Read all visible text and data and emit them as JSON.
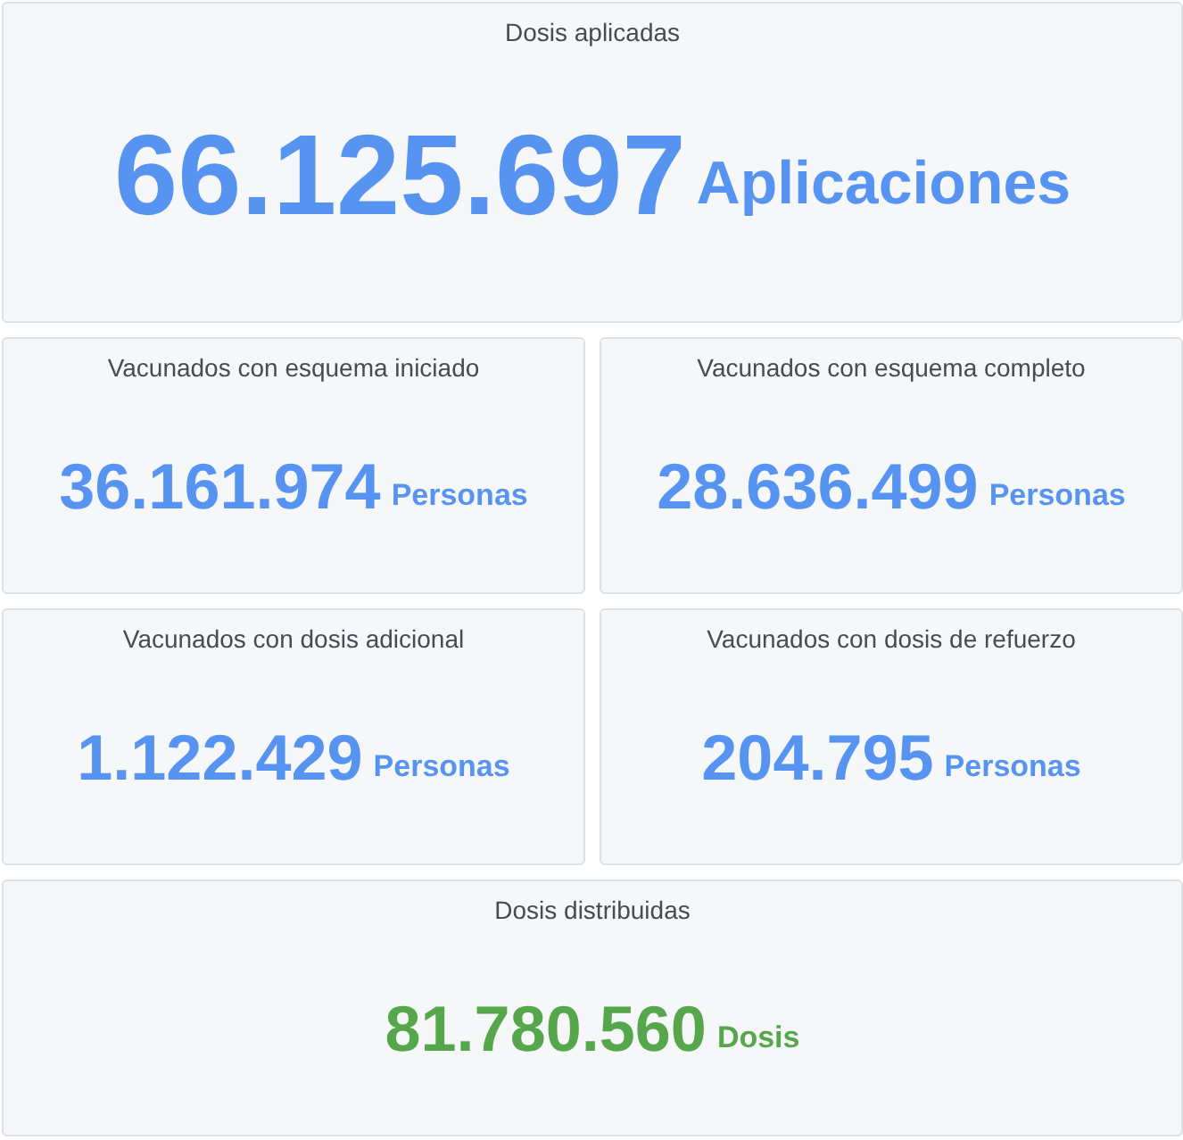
{
  "rows": [
    [
      {
        "kind": "hero",
        "title": "Dosis aplicadas",
        "value": "66.125.697",
        "unit": "Aplicaciones",
        "color": "#5794f2"
      }
    ],
    [
      {
        "kind": "stat",
        "title": "Vacunados con esquema iniciado",
        "value": "36.161.974",
        "unit": "Personas",
        "color": "#5794f2"
      },
      {
        "kind": "stat",
        "title": "Vacunados con esquema completo",
        "value": "28.636.499",
        "unit": "Personas",
        "color": "#5794f2"
      }
    ],
    [
      {
        "kind": "stat",
        "title": "Vacunados con dosis adicional",
        "value": "1.122.429",
        "unit": "Personas",
        "color": "#5794f2"
      },
      {
        "kind": "stat",
        "title": "Vacunados con dosis de refuerzo",
        "value": "204.795",
        "unit": "Personas",
        "color": "#5794f2"
      }
    ],
    [
      {
        "kind": "stat",
        "title": "Dosis distribuidas",
        "value": "81.780.560",
        "unit": "Dosis",
        "color": "#56a64b"
      }
    ]
  ]
}
